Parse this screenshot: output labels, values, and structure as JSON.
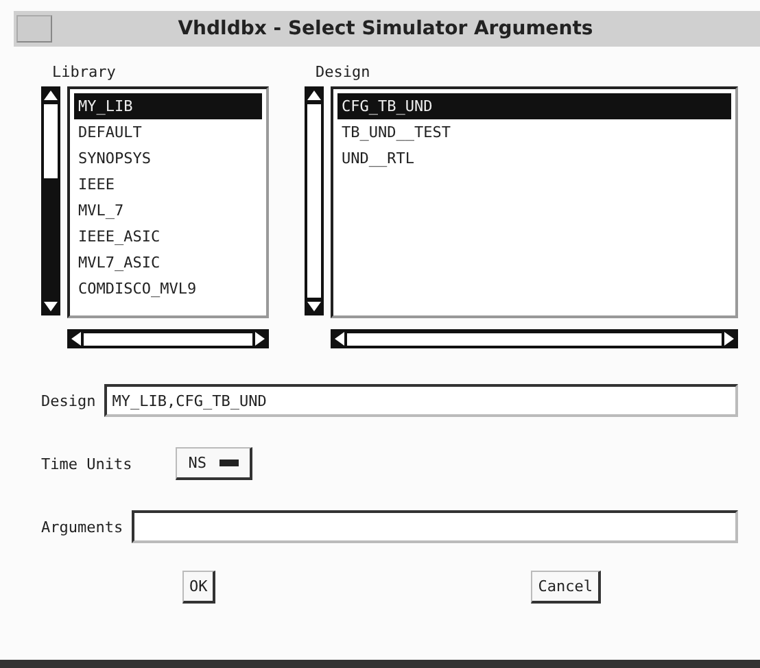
{
  "window": {
    "title": "Vhdldbx - Select Simulator Arguments"
  },
  "library": {
    "label": "Library",
    "items": [
      {
        "label": "MY_LIB",
        "selected": true
      },
      {
        "label": "DEFAULT",
        "selected": false
      },
      {
        "label": "SYNOPSYS",
        "selected": false
      },
      {
        "label": "IEEE",
        "selected": false
      },
      {
        "label": "MVL_7",
        "selected": false
      },
      {
        "label": "IEEE_ASIC",
        "selected": false
      },
      {
        "label": "MVL7_ASIC",
        "selected": false
      },
      {
        "label": "COMDISCO_MVL9",
        "selected": false
      }
    ]
  },
  "design_list": {
    "label": "Design",
    "items": [
      {
        "label": "CFG_TB_UND",
        "selected": true
      },
      {
        "label": "TB_UND__TEST",
        "selected": false
      },
      {
        "label": "UND__RTL",
        "selected": false
      }
    ]
  },
  "design_field": {
    "label": "Design",
    "value": "MY_LIB,CFG_TB_UND"
  },
  "time_units": {
    "label": "Time Units",
    "value": "NS"
  },
  "arguments": {
    "label": "Arguments"
  },
  "buttons": [
    "OK",
    "Cancel"
  ]
}
